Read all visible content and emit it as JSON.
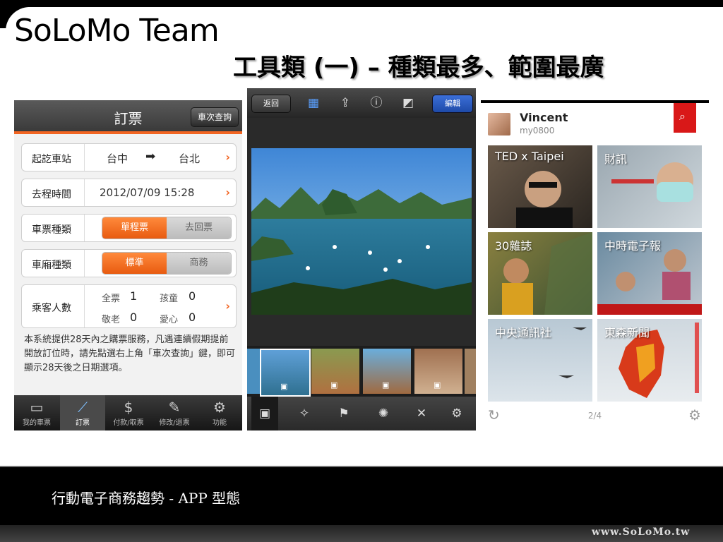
{
  "slide": {
    "logo": "SoLoMo Team",
    "title": "工具類 (一) – 種類最多、範圍最廣",
    "footer": "行動電子商務趨勢 - APP 型態",
    "url": "www.SoLoMo.tw"
  },
  "app_ticket": {
    "title": "訂票",
    "query_button": "車次查詢",
    "rows": {
      "station_label": "起訖車站",
      "from": "台中",
      "to": "台北",
      "time_label": "去程時間",
      "time_value": "2012/07/09 15:28",
      "ticket_type_label": "車票種類",
      "ticket_type_on": "單程票",
      "ticket_type_off": "去回票",
      "car_type_label": "車廂種類",
      "car_type_on": "標準",
      "car_type_off": "商務",
      "passenger_label": "乘客人數",
      "full_label": "全票",
      "full_value": "1",
      "child_label": "孩童",
      "child_value": "0",
      "senior_label": "敬老",
      "senior_value": "0",
      "love_label": "愛心",
      "love_value": "0"
    },
    "note": "本系統提供28天內之購票服務，凡遇連續假期提前開放訂位時，請先點選右上角「車次查詢」鍵，即可顯示28天後之日期選項。",
    "tabs": [
      "我的車票",
      "訂票",
      "付款/取票",
      "修改/退票",
      "功能"
    ],
    "active_tab": 1
  },
  "app_photo": {
    "back_button": "返回",
    "edit_button": "編輯",
    "top_icons": [
      "grid-icon",
      "share-icon",
      "info-icon",
      "compose-icon"
    ],
    "bottom_icons": [
      "briefcase-icon",
      "magic-wand-icon",
      "flag-icon",
      "effects-icon",
      "close-icon",
      "gear-icon"
    ]
  },
  "app_news": {
    "user_name": "Vincent",
    "user_handle": "my0800",
    "tiles": [
      "TED x Taipei",
      "財訊",
      "30雜誌",
      "中時電子報",
      "中央通訊社",
      "東森新聞"
    ],
    "page": "2/4"
  },
  "colors": {
    "orange": "#f26522",
    "red": "#d91818",
    "blue": "#1e4aa8"
  }
}
